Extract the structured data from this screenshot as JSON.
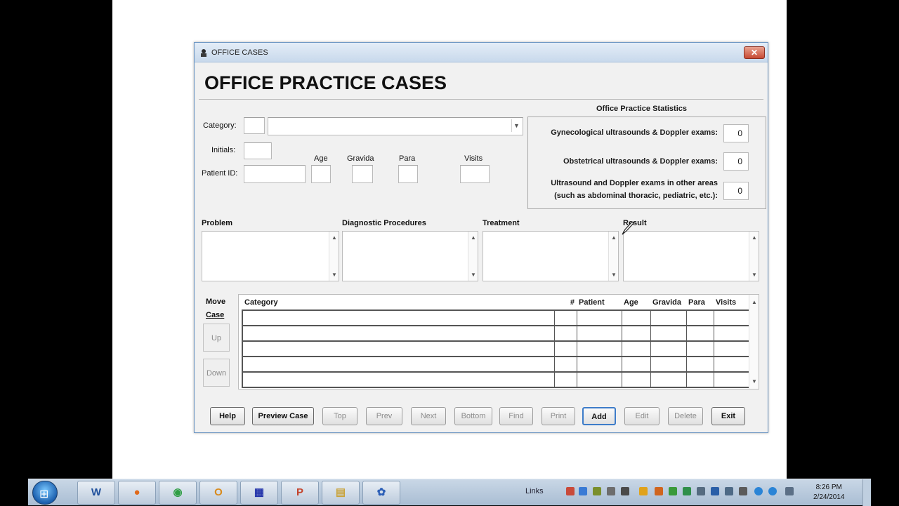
{
  "window": {
    "title": "OFFICE CASES",
    "close_glyph": "✕",
    "heading": "OFFICE PRACTICE CASES"
  },
  "form": {
    "category_label": "Category:",
    "initials_label": "Initials:",
    "patient_id_label": "Patient ID:",
    "age_label": "Age",
    "gravida_label": "Gravida",
    "para_label": "Para",
    "visits_label": "Visits",
    "dropdown_arrow": "▼"
  },
  "stats": {
    "title": "Office Practice Statistics",
    "gyn_label": "Gynecological ultrasounds & Doppler exams:",
    "gyn_value": "0",
    "obs_label": "Obstetrical ultrasounds & Doppler exams:",
    "obs_value": "0",
    "other_label_line1": "Ultrasound and Doppler exams in other areas",
    "other_label_line2": "(such as abdominal thoracic, pediatric, etc.):",
    "other_value": "0"
  },
  "sections": {
    "problem": "Problem",
    "diagnostic": "Diagnostic Procedures",
    "treatment": "Treatment",
    "result": "Result"
  },
  "grid": {
    "columns": [
      "Category",
      "#",
      "Patient",
      "Age",
      "Gravida",
      "Para",
      "Visits"
    ],
    "row_count": 5
  },
  "move_case": {
    "label_line1": "Move",
    "label_line2": "Case",
    "up": "Up",
    "down": "Down"
  },
  "buttons": {
    "help": "Help",
    "preview_case": "Preview Case",
    "top": "Top",
    "prev": "Prev",
    "next": "Next",
    "bottom": "Bottom",
    "find": "Find",
    "print": "Print",
    "add": "Add",
    "edit": "Edit",
    "delete": "Delete",
    "exit": "Exit"
  },
  "taskbar": {
    "start_glyph": "⊞",
    "apps": [
      {
        "name": "word",
        "glyph": "W",
        "color": "#1e4f9c"
      },
      {
        "name": "firefox",
        "glyph": "●",
        "color": "#e06a1b"
      },
      {
        "name": "chrome",
        "glyph": "◉",
        "color": "#2f9e44"
      },
      {
        "name": "outlook",
        "glyph": "O",
        "color": "#d88a1c"
      },
      {
        "name": "project",
        "glyph": "▦",
        "color": "#2233aa"
      },
      {
        "name": "powerpoint",
        "glyph": "P",
        "color": "#c4432b"
      },
      {
        "name": "explorer",
        "glyph": "▤",
        "color": "#c9a33a"
      },
      {
        "name": "app-flower",
        "glyph": "✿",
        "color": "#2c5fb7"
      }
    ],
    "links_label": "Links",
    "time": "8:26 PM",
    "date": "2/24/2014"
  }
}
